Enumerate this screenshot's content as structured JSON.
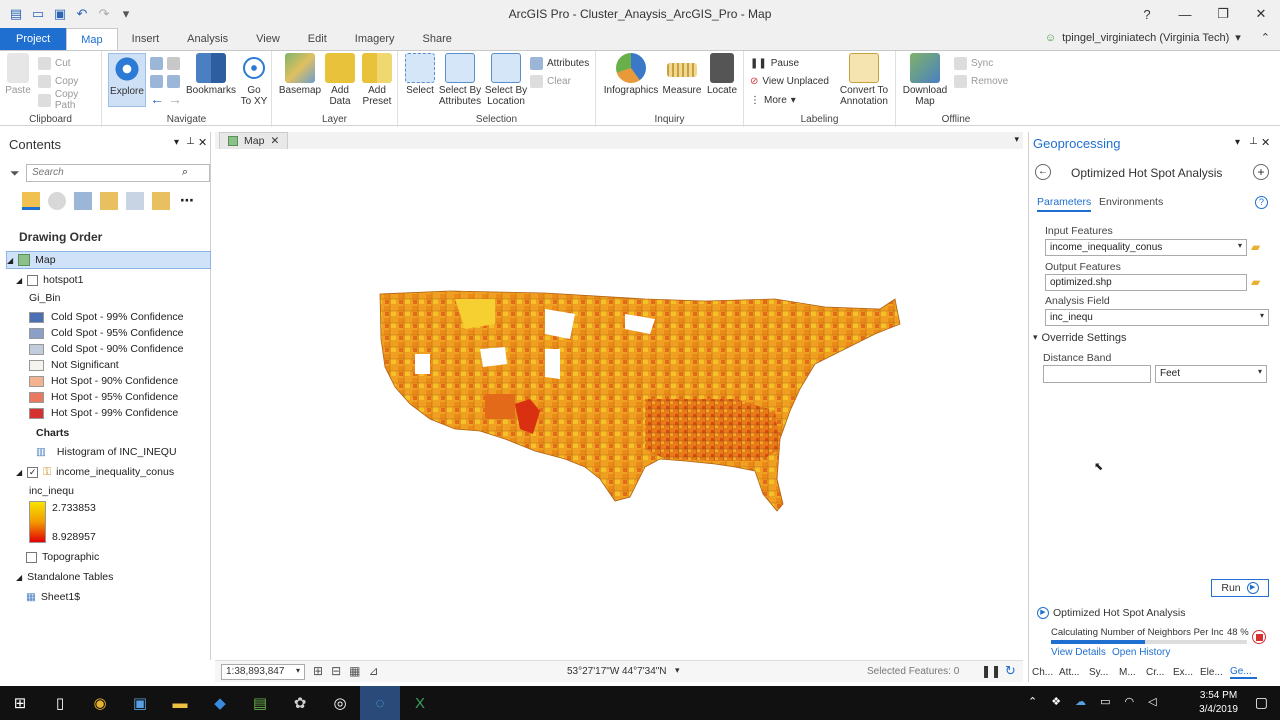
{
  "window": {
    "title": "ArcGIS Pro - Cluster_Anaysis_ArcGIS_Pro - Map",
    "help": "?",
    "minimize": "—",
    "restore": "❐",
    "close": "✕"
  },
  "tabs": [
    "Project",
    "Map",
    "Insert",
    "Analysis",
    "View",
    "Edit",
    "Imagery",
    "Share"
  ],
  "user": {
    "name": "tpingel_virginiatech (Virginia Tech)"
  },
  "ribbon": {
    "clipboard": {
      "label": "Clipboard",
      "paste": "Paste",
      "cut": "Cut",
      "copy": "Copy",
      "copy_path": "Copy Path"
    },
    "navigate": {
      "label": "Navigate",
      "explore": "Explore",
      "bookmarks": "Bookmarks",
      "goto": "Go\nTo XY"
    },
    "layer": {
      "label": "Layer",
      "basemap": "Basemap",
      "add_data": "Add\nData",
      "add_preset": "Add\nPreset"
    },
    "selection": {
      "label": "Selection",
      "select": "Select",
      "by_attr": "Select By\nAttributes",
      "by_loc": "Select By\nLocation",
      "attributes": "Attributes",
      "clear": "Clear"
    },
    "inquiry": {
      "label": "Inquiry",
      "infographics": "Infographics",
      "measure": "Measure",
      "locate": "Locate"
    },
    "labeling": {
      "label": "Labeling",
      "pause": "Pause",
      "view_unplaced": "View Unplaced",
      "more": "More",
      "convert": "Convert To\nAnnotation"
    },
    "offline": {
      "label": "Offline",
      "download": "Download\nMap",
      "sync": "Sync",
      "remove": "Remove"
    }
  },
  "contents": {
    "title": "Contents",
    "search_placeholder": "Search",
    "drawing_order": "Drawing Order",
    "map": "Map",
    "hotspot_layer": "hotspot1",
    "gi_bin": "Gi_Bin",
    "legend": [
      {
        "label": "Cold Spot - 99% Confidence",
        "color": "#4a6fb3"
      },
      {
        "label": "Cold Spot - 95% Confidence",
        "color": "#8aa0c6"
      },
      {
        "label": "Cold Spot - 90% Confidence",
        "color": "#c2ccdc"
      },
      {
        "label": "Not Significant",
        "color": "#f5f3ee"
      },
      {
        "label": "Hot Spot - 90% Confidence",
        "color": "#f3b38e"
      },
      {
        "label": "Hot Spot - 95% Confidence",
        "color": "#e8785e"
      },
      {
        "label": "Hot Spot - 99% Confidence",
        "color": "#d63131"
      }
    ],
    "charts": "Charts",
    "histogram": "Histogram of INC_INEQU",
    "income_layer": "income_inequality_conus",
    "inc_field": "inc_inequ",
    "range_high": "2.733853",
    "range_low": "8.928957",
    "topographic": "Topographic",
    "standalone": "Standalone Tables",
    "sheet": "Sheet1$"
  },
  "map": {
    "tab": "Map",
    "scale": "1:38,893,847",
    "coords": "53°27'17\"W 44°7'34\"N",
    "selected": "Selected Features: 0"
  },
  "geo": {
    "title": "Geoprocessing",
    "tool": "Optimized Hot Spot Analysis",
    "tab_params": "Parameters",
    "tab_env": "Environments",
    "input_label": "Input Features",
    "input_value": "income_inequality_conus",
    "output_label": "Output Features",
    "output_value": "optimized.shp",
    "field_label": "Analysis Field",
    "field_value": "inc_inequ",
    "override": "Override Settings",
    "distance_label": "Distance Band",
    "distance_unit": "Feet",
    "run": "Run",
    "progress_tool": "Optimized Hot Spot Analysis",
    "progress_msg": "Calculating Number of Neighbors Per Incr",
    "progress_pct": "48 %",
    "progress_value": 0.48,
    "view_details": "View Details",
    "open_history": "Open History"
  },
  "bottom_tabs": [
    "Ch...",
    "Att...",
    "Sy...",
    "M...",
    "Cr...",
    "Ex...",
    "Ele...",
    "Ge..."
  ],
  "clock": {
    "time": "3:54 PM",
    "date": "3/4/2019"
  }
}
